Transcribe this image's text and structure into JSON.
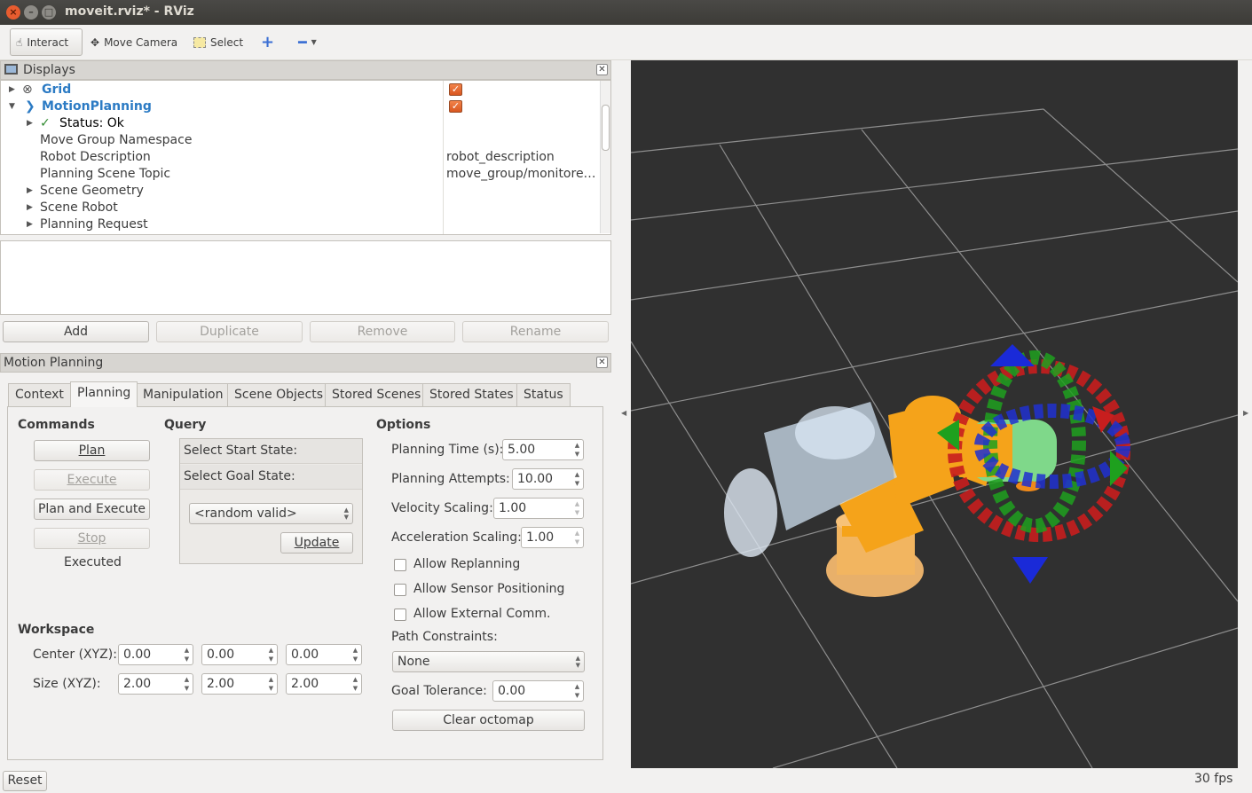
{
  "window": {
    "title": "moveit.rviz* - RViz",
    "close": "×",
    "minimize": "–",
    "maximize": "□"
  },
  "toolbar": {
    "interact": "Interact",
    "move_camera": "Move Camera",
    "select": "Select",
    "add_icon": "plus-icon",
    "remove_icon": "minus-icon"
  },
  "displays": {
    "title": "Displays",
    "tree": [
      {
        "name": "Grid",
        "value": "",
        "checked": true
      },
      {
        "name": "MotionPlanning",
        "value": "",
        "checked": true
      },
      {
        "name": "Status: Ok",
        "value": ""
      },
      {
        "name": "Move Group Namespace",
        "value": ""
      },
      {
        "name": "Robot Description",
        "value": "robot_description"
      },
      {
        "name": "Planning Scene Topic",
        "value": "move_group/monitore…"
      },
      {
        "name": "Scene Geometry",
        "value": ""
      },
      {
        "name": "Scene Robot",
        "value": ""
      },
      {
        "name": "Planning Request",
        "value": ""
      }
    ],
    "buttons": {
      "add": "Add",
      "duplicate": "Duplicate",
      "remove": "Remove",
      "rename": "Rename"
    }
  },
  "motion_planning": {
    "title": "Motion Planning",
    "tabs": [
      "Context",
      "Planning",
      "Manipulation",
      "Scene Objects",
      "Stored Scenes",
      "Stored States",
      "Status"
    ],
    "active_tab": "Planning",
    "commands": {
      "header": "Commands",
      "plan": "Plan",
      "execute": "Execute",
      "plan_and_execute": "Plan and Execute",
      "stop": "Stop",
      "status": "Executed"
    },
    "query": {
      "header": "Query",
      "select_start": "Select Start State:",
      "select_goal": "Select Goal State:",
      "goal_option": "<random valid>",
      "update": "Update"
    },
    "options": {
      "header": "Options",
      "planning_time_label": "Planning Time (s):",
      "planning_time": "5.00",
      "planning_attempts_label": "Planning Attempts:",
      "planning_attempts": "10.00",
      "velocity_scaling_label": "Velocity Scaling:",
      "velocity_scaling": "1.00",
      "acceleration_scaling_label": "Acceleration Scaling:",
      "acceleration_scaling": "1.00",
      "allow_replanning": "Allow Replanning",
      "allow_sensor_positioning": "Allow Sensor Positioning",
      "allow_external_comm": "Allow External Comm.",
      "path_constraints_label": "Path Constraints:",
      "path_constraints": "None",
      "goal_tolerance_label": "Goal Tolerance:",
      "goal_tolerance": "0.00",
      "clear_octomap": "Clear octomap"
    },
    "workspace": {
      "header": "Workspace",
      "center_label": "Center (XYZ):",
      "center": [
        "0.00",
        "0.00",
        "0.00"
      ],
      "size_label": "Size (XYZ):",
      "size": [
        "2.00",
        "2.00",
        "2.00"
      ]
    }
  },
  "status_bar": {
    "reset": "Reset",
    "fps": "30 fps"
  },
  "colors": {
    "viewport_bg": "#303030",
    "grid": "#a0a0a0",
    "robot": "#f5a31a",
    "accent_blue": "#2c7bc4"
  }
}
